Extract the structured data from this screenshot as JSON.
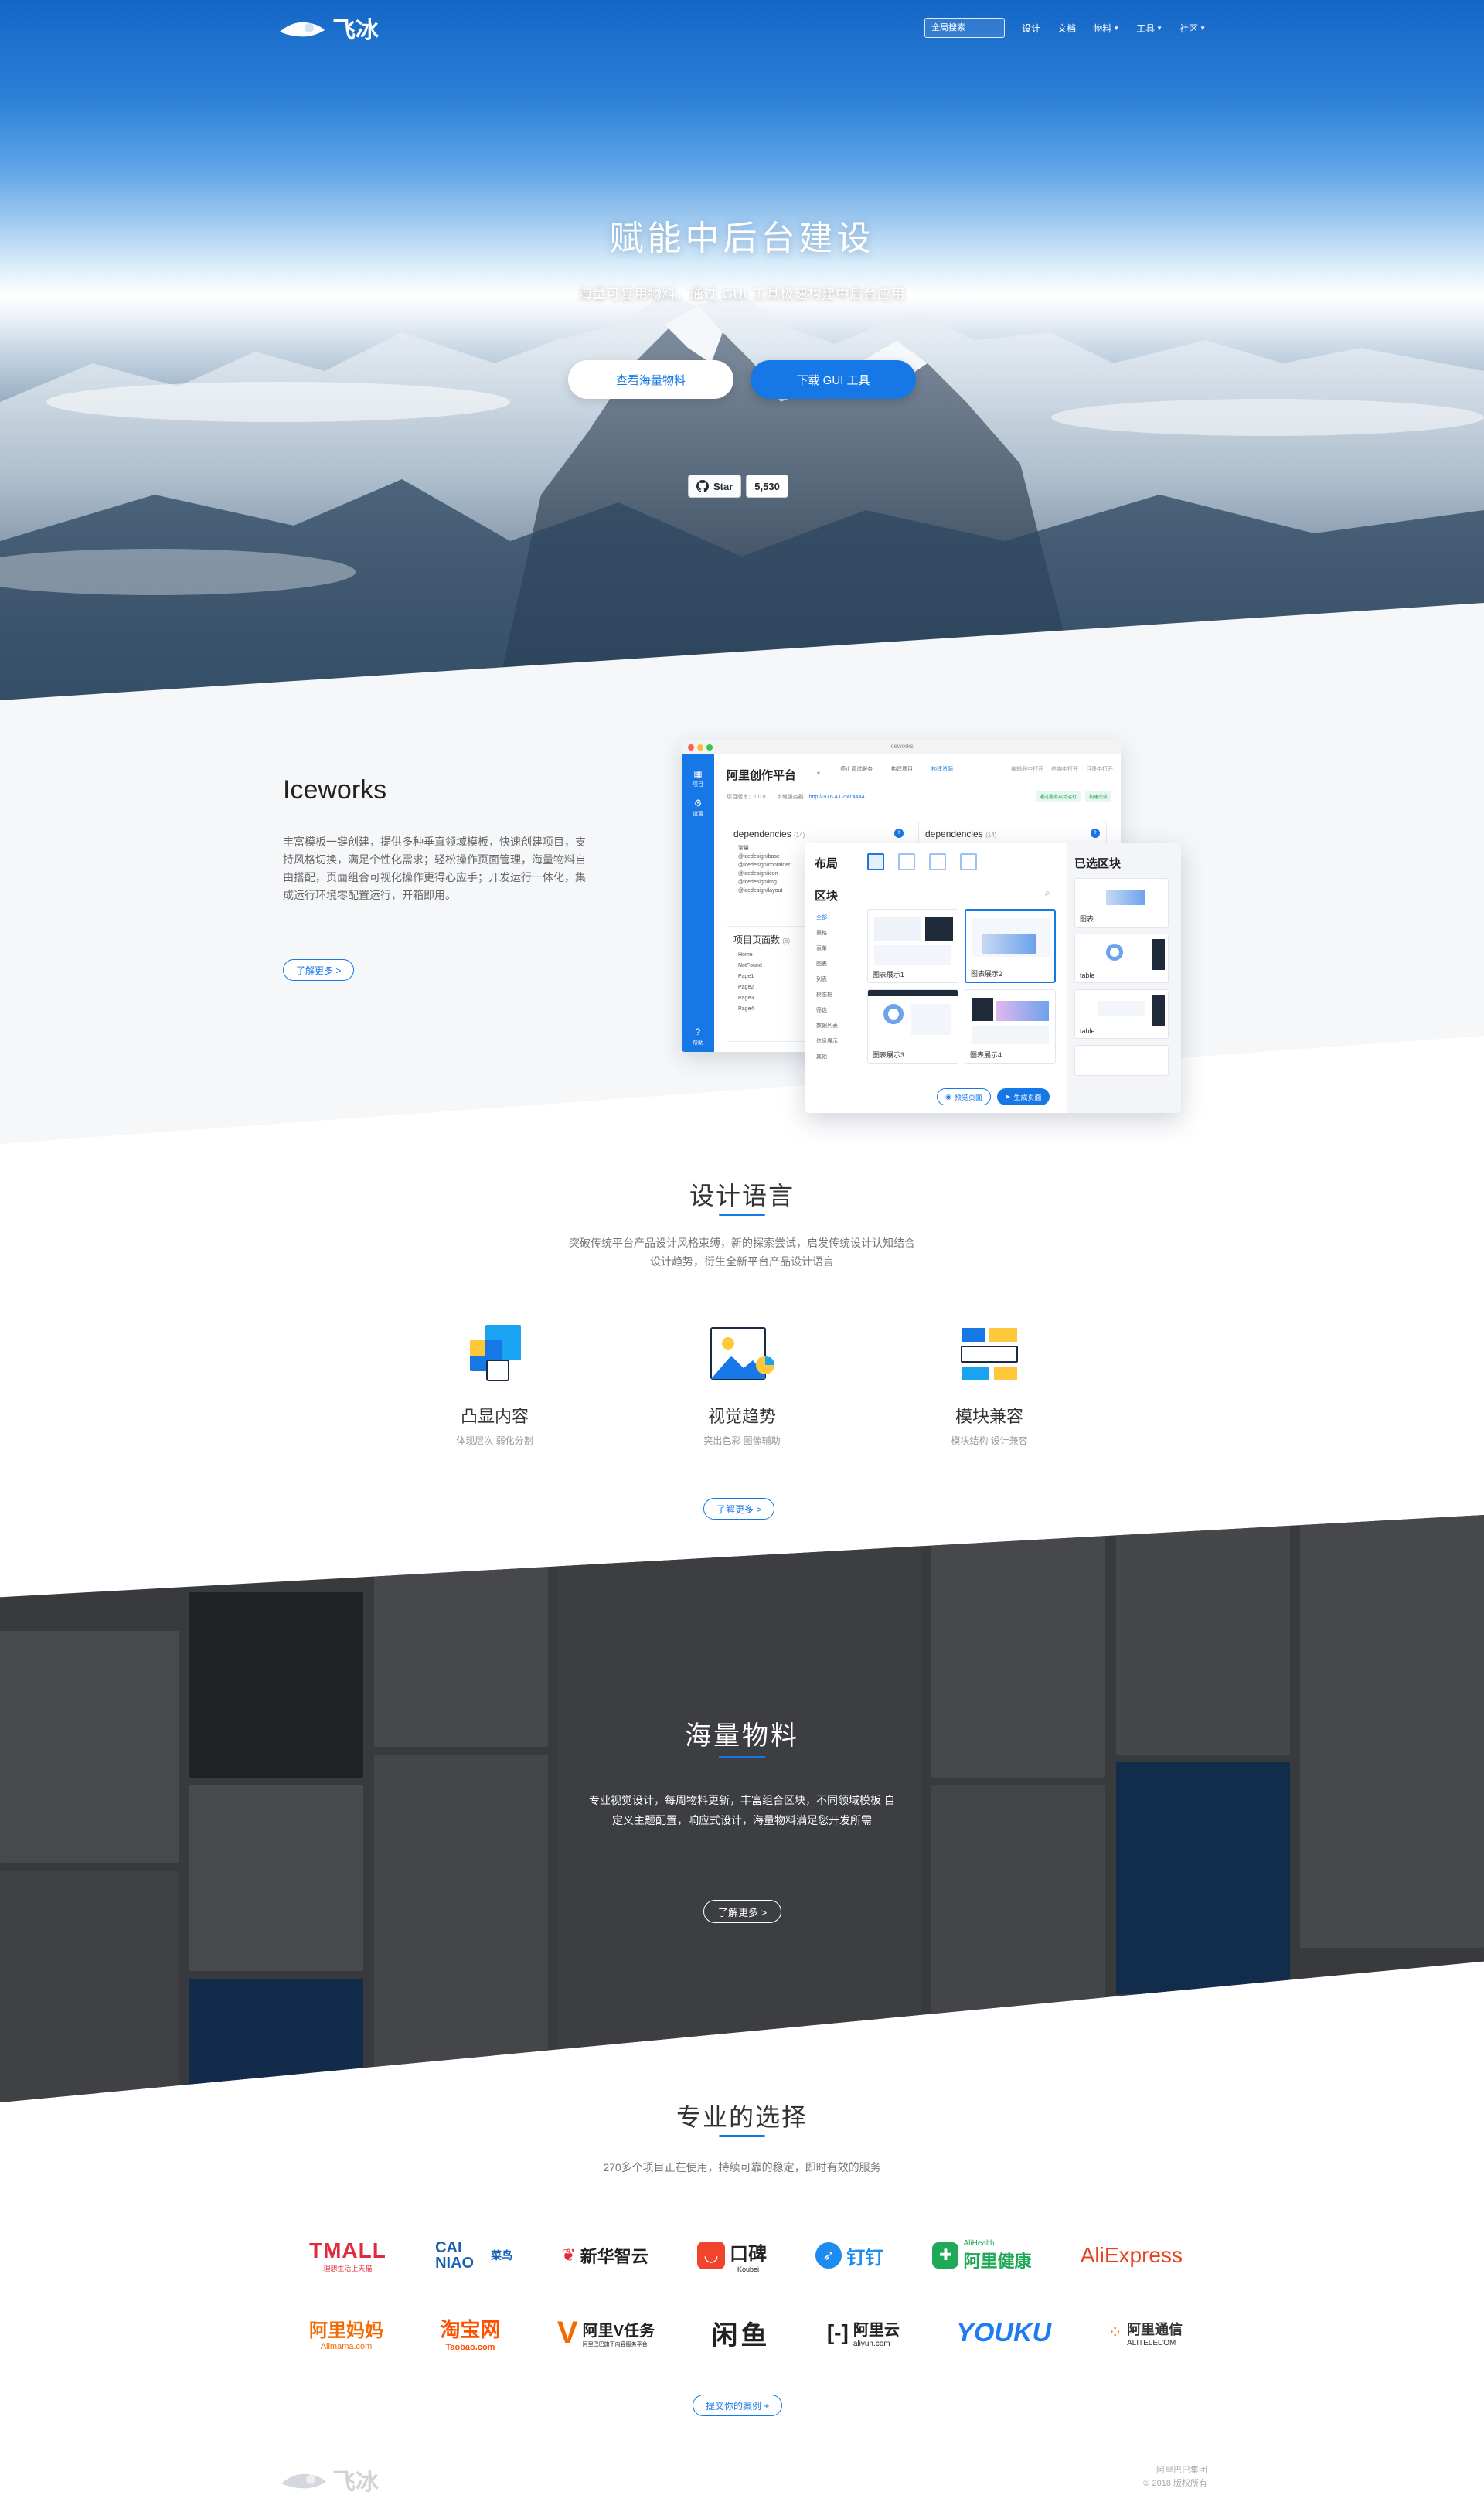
{
  "nav": {
    "logo_text": "飞冰",
    "search_placeholder": "全局搜索",
    "links": [
      {
        "label": "设计",
        "dropdown": false
      },
      {
        "label": "文档",
        "dropdown": false
      },
      {
        "label": "物料",
        "dropdown": true
      },
      {
        "label": "工具",
        "dropdown": true
      },
      {
        "label": "社区",
        "dropdown": true
      }
    ]
  },
  "hero": {
    "title": "赋能中后台建设",
    "subtitle": "海量可复用物料，通过 GUI 工具极速构建中后台应用",
    "btn_materials": "查看海量物料",
    "btn_download": "下载 GUI 工具",
    "github_star": "Star",
    "github_count": "5,530"
  },
  "iceworks": {
    "title": "Iceworks",
    "description": "丰富模板一键创建，提供多种垂直领域模板，快速创建项目，支持风格切换，满足个性化需求；轻松操作页面管理，海量物料自由搭配，页面组合可视化操作更得心应手；开发运行一体化，集成运行环境零配置运行，开箱即用。",
    "more": "了解更多 >",
    "screenshot": {
      "window_title": "Iceworks",
      "app_title": "阿里创作平台",
      "version_label": "项目版本：1.0.0",
      "server_label": "本地服务器：",
      "server_url": "http://30.6.43.250:4444",
      "tags": [
        "通过服务启动运行",
        "构建完成"
      ],
      "top_tabs": [
        "停止调试服务",
        "构建项目",
        "构建资源"
      ],
      "top_right": [
        "编辑器中打开",
        "终端中打开",
        "目录中打开"
      ],
      "sidebar": [
        "项目",
        "设置",
        "帮助"
      ],
      "panel_deps": "dependencies",
      "panel_deps_count": "(14)",
      "deps": [
        "@icedesign/base",
        "@icedesign/container",
        "@icedesign/icon",
        "@icedesign/img",
        "@icedesign/layout"
      ],
      "deps_first": "常量",
      "panel_pages": "项目页面数",
      "panel_pages_count": "(6)",
      "pages": [
        "Home",
        "NotFound",
        "Page1",
        "Page2",
        "Page3",
        "Page4"
      ],
      "layout_label": "布局",
      "block_label": "区块",
      "selected_label": "已选区块",
      "categories": [
        "全部",
        "表格",
        "表单",
        "图表",
        "列表",
        "模态框",
        "筛选",
        "数据列表",
        "信息展示",
        "其他"
      ],
      "thumbs": [
        "图表展示1",
        "图表展示2",
        "图表展示3",
        "图表展示4"
      ],
      "selected_caps": [
        "图表",
        "table",
        "table"
      ],
      "btn_preview": "预览页面",
      "btn_generate": "生成页面"
    }
  },
  "design": {
    "title": "设计语言",
    "desc_line1": "突破传统平台产品设计风格束缚，新的探索尝试，启发传统设计认知结合",
    "desc_line2": "设计趋势，衍生全新平台产品设计语言",
    "features": [
      {
        "title": "凸显内容",
        "sub": "体现层次 弱化分割",
        "icon": "layers-icon"
      },
      {
        "title": "视觉趋势",
        "sub": "突出色彩 图像辅助",
        "icon": "image-icon"
      },
      {
        "title": "模块兼容",
        "sub": "模块结构 设计兼容",
        "icon": "modules-icon"
      }
    ],
    "more": "了解更多 >"
  },
  "materials": {
    "title": "海量物料",
    "desc_line1": "专业视觉设计，每周物料更新，丰富组合区块，不同领域模板 自",
    "desc_line2": "定义主题配置，响应式设计，海量物料满足您开发所需",
    "more": "了解更多 >"
  },
  "partners": {
    "title": "专业的选择",
    "desc": "270多个项目正在使用，持续可靠的稳定，即时有效的服务",
    "row1": [
      {
        "name": "TMALL",
        "sub": "理想生活上天猫",
        "color": "#e02b3c"
      },
      {
        "name": "CAI NIAO",
        "sub": "菜鸟",
        "color": "#1a5fb4"
      },
      {
        "name": "新华智云",
        "sub": "",
        "color": "#222222"
      },
      {
        "name": "口碑",
        "sub": "Koubei",
        "color": "#222222"
      },
      {
        "name": "钉钉",
        "sub": "",
        "color": "#1d8cf0"
      },
      {
        "name": "阿里健康",
        "sub": "AliHealth",
        "color": "#1fa855"
      },
      {
        "name": "AliExpress",
        "sub": "",
        "color": "#e8411b"
      }
    ],
    "row2": [
      {
        "name": "阿里妈妈",
        "sub": "Alimama.com",
        "color": "#f56a00"
      },
      {
        "name": "淘宝网",
        "sub": "Taobao.com",
        "color": "#ff5000"
      },
      {
        "name": "阿里V任务",
        "sub": "阿里巴巴旗下内容服务平台",
        "color": "#222222"
      },
      {
        "name": "闲鱼",
        "sub": "",
        "color": "#222222"
      },
      {
        "name": "阿里云",
        "sub": "aliyun.com",
        "color": "#222222"
      },
      {
        "name": "YOUKU",
        "sub": "",
        "color": "#1f7bf2"
      },
      {
        "name": "阿里通信",
        "sub": "ALITELECOM",
        "color": "#333333"
      }
    ],
    "submit": "提交你的案例 +"
  },
  "footer": {
    "logo_text": "飞冰",
    "line1": "阿里巴巴集团",
    "line2": "© 2018 版权所有"
  }
}
